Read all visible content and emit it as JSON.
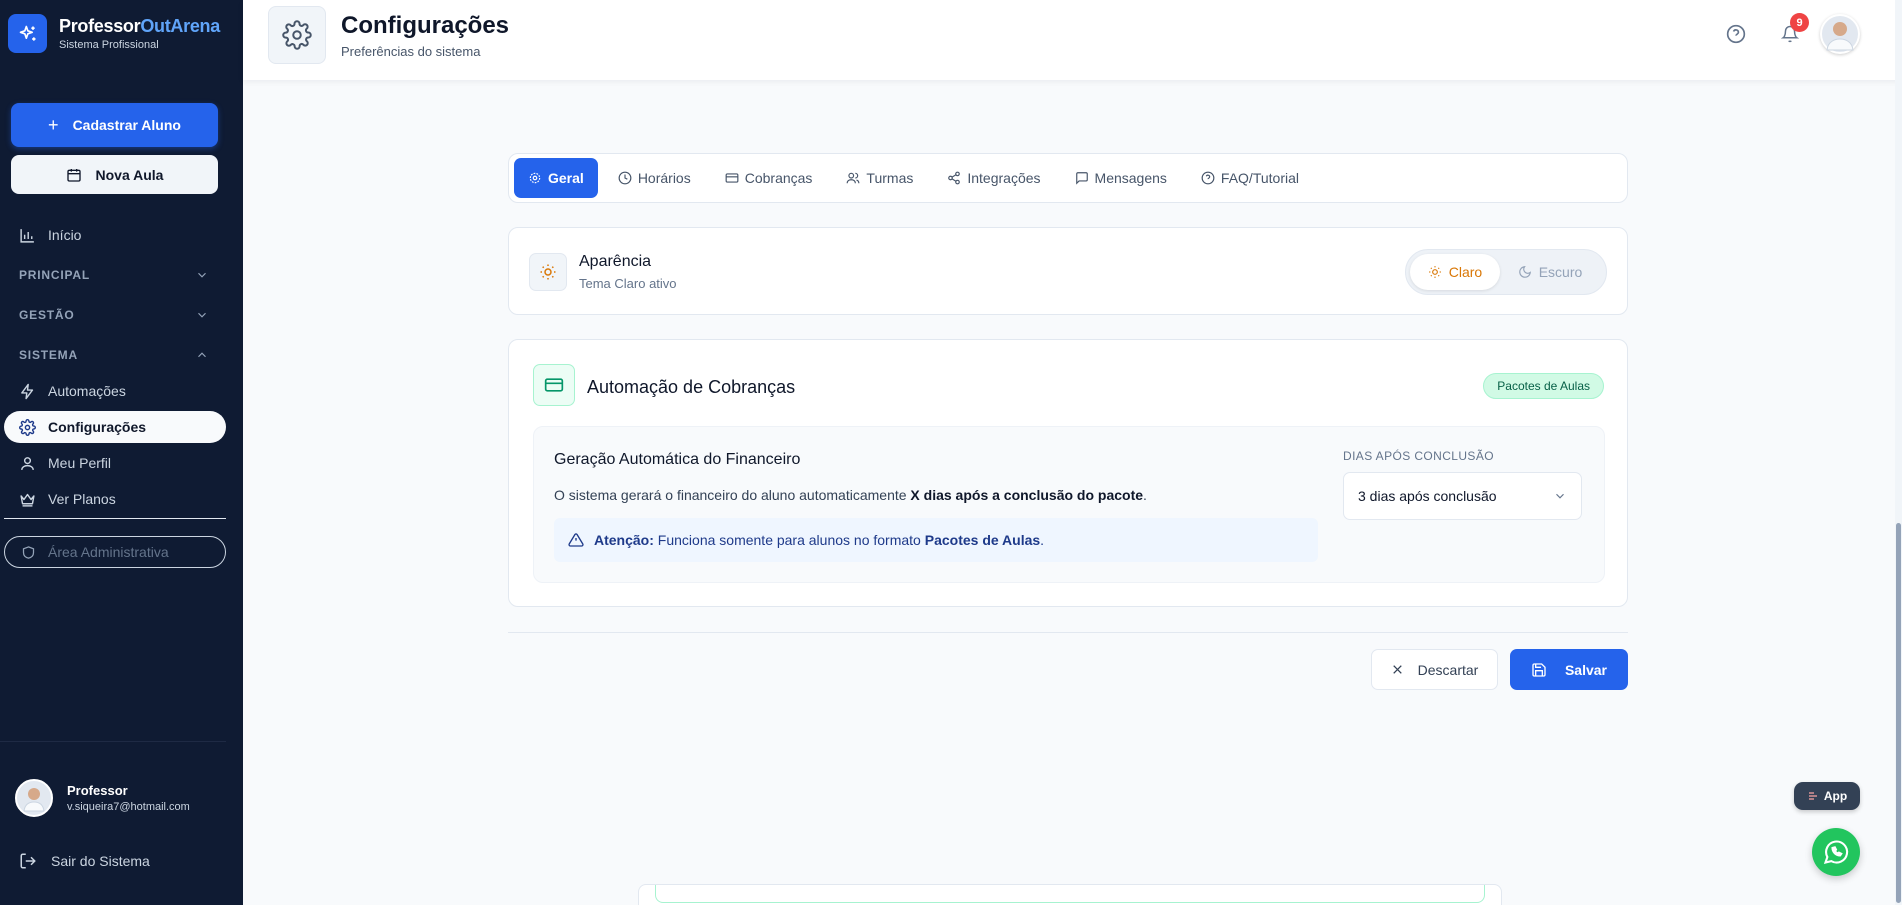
{
  "brand": {
    "name_part1": "Professor",
    "name_part2": "OutArena",
    "subtitle": "Sistema Profissional"
  },
  "sidebar": {
    "primary_button": "Cadastrar Aluno",
    "secondary_button": "Nova Aula",
    "home": "Início",
    "sections": {
      "principal": "PRINCIPAL",
      "gestao": "GESTÃO",
      "sistema": "SISTEMA"
    },
    "items": [
      "Automações",
      "Configurações",
      "Meu Perfil",
      "Ver Planos"
    ],
    "admin": "Área Administrativa",
    "user": {
      "name": "Professor",
      "email": "v.siqueira7@hotmail.com"
    },
    "logout": "Sair do Sistema"
  },
  "header": {
    "title": "Configurações",
    "subtitle": "Preferências do sistema",
    "notification_count": "9"
  },
  "tabs": [
    "Geral",
    "Horários",
    "Cobranças",
    "Turmas",
    "Integrações",
    "Mensagens",
    "FAQ/Tutorial"
  ],
  "appearance": {
    "title": "Aparência",
    "subtitle": "Tema Claro ativo",
    "light": "Claro",
    "dark": "Escuro"
  },
  "automation": {
    "title": "Automação de Cobranças",
    "badge": "Pacotes de Aulas",
    "inner_title": "Geração Automática do Financeiro",
    "desc_prefix": "O sistema gerará o financeiro do aluno automaticamente ",
    "desc_bold": "X dias após a conclusão do pacote",
    "desc_suffix": ".",
    "warn_label": "Atenção:",
    "warn_text": " Funciona somente para alunos no formato ",
    "warn_bold": "Pacotes de Aulas",
    "warn_suffix": ".",
    "days_label": "DIAS APÓS CONCLUSÃO",
    "days_value": "3 dias após conclusão"
  },
  "actions": {
    "discard": "Descartar",
    "save": "Salvar"
  },
  "floating": {
    "app": "App"
  },
  "colors": {
    "sidebar_bg": "#0f1b33",
    "primary": "#2563eb",
    "success_bg": "#d1fae5",
    "whatsapp": "#22c55e",
    "badge": "#ef4444"
  }
}
